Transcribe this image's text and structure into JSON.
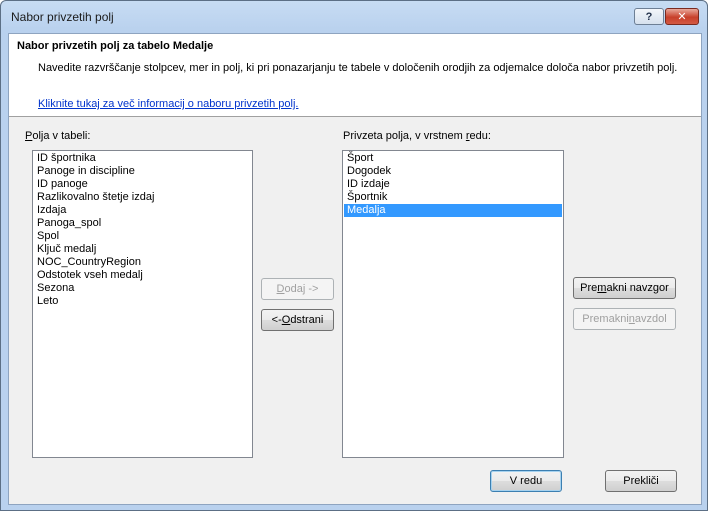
{
  "window": {
    "title": "Nabor privzetih polj",
    "help_glyph": "?",
    "close_glyph": "✕"
  },
  "header": {
    "title": "Nabor privzetih polj za tabelo Medalje",
    "description": "Navedite razvrščanje stolpcev, mer in polj, ki pri ponazarjanju te tabele v določenih orodjih za odjemalce določa nabor privzetih polj.",
    "link": "Kliknite tukaj za več informacij o naboru privzetih polj."
  },
  "fields": {
    "label_access": "P",
    "label_rest": "olja v tabeli:",
    "items": [
      "ID športnika",
      "Panoge in discipline",
      "ID panoge",
      "Razlikovalno štetje izdaj",
      "Izdaja",
      "Panoga_spol",
      "Spol",
      "Ključ medalj",
      "NOC_CountryRegion",
      "Odstotek vseh medalj",
      "Sezona",
      "Leto"
    ]
  },
  "default_fields": {
    "label_pre": "Privzeta polja, v vrstnem ",
    "label_access": "r",
    "label_post": "edu:",
    "items": [
      "Šport",
      "Dogodek",
      "ID izdaje",
      "Športnik",
      "Medalja"
    ],
    "selected": "Medalja"
  },
  "buttons": {
    "add_access": "D",
    "add_rest": "odaj ->",
    "remove_pre": "<- ",
    "remove_access": "O",
    "remove_rest": "dstrani",
    "move_up_pre": "Pre",
    "move_up_access": "m",
    "move_up_post": "akni navzgor",
    "move_down_pre": "Premakni ",
    "move_down_access": "n",
    "move_down_post": "avzdol",
    "ok": "V redu",
    "cancel": "Prekliči"
  }
}
